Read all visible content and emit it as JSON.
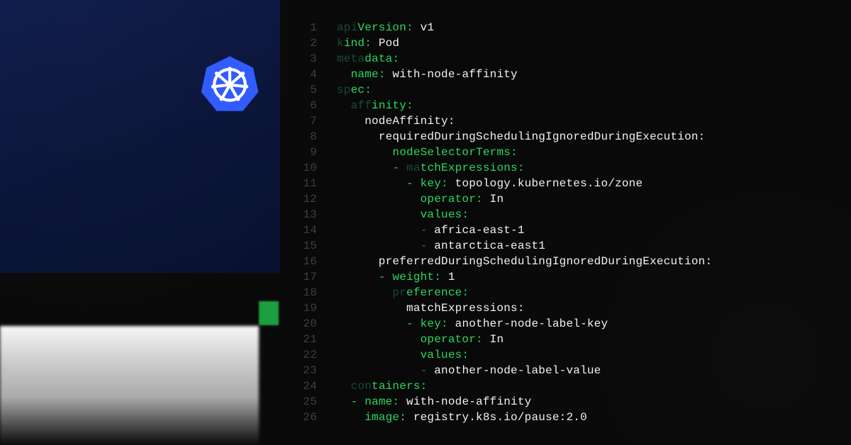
{
  "code": {
    "lines": [
      {
        "n": "1",
        "tokens": [
          {
            "cls": "dim",
            "t": "api"
          },
          {
            "cls": "key",
            "t": "Version:"
          },
          {
            "cls": "val",
            "t": " v1"
          }
        ]
      },
      {
        "n": "2",
        "tokens": [
          {
            "cls": "dim",
            "t": "k"
          },
          {
            "cls": "key",
            "t": "ind:"
          },
          {
            "cls": "val",
            "t": " Pod"
          }
        ]
      },
      {
        "n": "3",
        "tokens": [
          {
            "cls": "dim",
            "t": "meta"
          },
          {
            "cls": "key",
            "t": "data:"
          }
        ]
      },
      {
        "n": "4",
        "tokens": [
          {
            "cls": "val",
            "t": "  "
          },
          {
            "cls": "key",
            "t": "name:"
          },
          {
            "cls": "val",
            "t": " with-node-affinity"
          }
        ]
      },
      {
        "n": "5",
        "tokens": [
          {
            "cls": "dim",
            "t": "sp"
          },
          {
            "cls": "key",
            "t": "ec:"
          }
        ]
      },
      {
        "n": "6",
        "tokens": [
          {
            "cls": "val",
            "t": "  "
          },
          {
            "cls": "dim",
            "t": "aff"
          },
          {
            "cls": "key",
            "t": "inity:"
          }
        ]
      },
      {
        "n": "7",
        "tokens": [
          {
            "cls": "val",
            "t": "    nodeAffinity:"
          }
        ]
      },
      {
        "n": "8",
        "tokens": [
          {
            "cls": "val",
            "t": "      requiredDuringSchedulingIgnoredDuringExecution:"
          }
        ]
      },
      {
        "n": "9",
        "tokens": [
          {
            "cls": "val",
            "t": "        "
          },
          {
            "cls": "key",
            "t": "nodeSelectorTerms:"
          }
        ]
      },
      {
        "n": "10",
        "tokens": [
          {
            "cls": "val",
            "t": "        "
          },
          {
            "cls": "dash",
            "t": "- "
          },
          {
            "cls": "dim",
            "t": "ma"
          },
          {
            "cls": "key",
            "t": "tchExpressions:"
          }
        ]
      },
      {
        "n": "11",
        "tokens": [
          {
            "cls": "val",
            "t": "          "
          },
          {
            "cls": "dash",
            "t": "- "
          },
          {
            "cls": "key",
            "t": "key:"
          },
          {
            "cls": "val",
            "t": " topology.kubernetes.io/zone"
          }
        ]
      },
      {
        "n": "12",
        "tokens": [
          {
            "cls": "val",
            "t": "            "
          },
          {
            "cls": "key",
            "t": "operator:"
          },
          {
            "cls": "val",
            "t": " In"
          }
        ]
      },
      {
        "n": "13",
        "tokens": [
          {
            "cls": "val",
            "t": "            "
          },
          {
            "cls": "key",
            "t": "values:"
          }
        ]
      },
      {
        "n": "14",
        "tokens": [
          {
            "cls": "val",
            "t": "            "
          },
          {
            "cls": "dimw",
            "t": "- "
          },
          {
            "cls": "val",
            "t": "africa-east-1"
          }
        ]
      },
      {
        "n": "15",
        "tokens": [
          {
            "cls": "val",
            "t": "            "
          },
          {
            "cls": "dimw",
            "t": "- "
          },
          {
            "cls": "val",
            "t": "antarctica-east1"
          }
        ]
      },
      {
        "n": "16",
        "tokens": [
          {
            "cls": "val",
            "t": "      preferredDuringSchedulingIgnoredDuringExecution:"
          }
        ]
      },
      {
        "n": "17",
        "tokens": [
          {
            "cls": "val",
            "t": "      "
          },
          {
            "cls": "dash",
            "t": "- "
          },
          {
            "cls": "key",
            "t": "weight:"
          },
          {
            "cls": "num",
            "t": " 1"
          }
        ]
      },
      {
        "n": "18",
        "tokens": [
          {
            "cls": "val",
            "t": "        "
          },
          {
            "cls": "dim",
            "t": "pr"
          },
          {
            "cls": "key",
            "t": "eference:"
          }
        ]
      },
      {
        "n": "19",
        "tokens": [
          {
            "cls": "val",
            "t": "          matchExpressions:"
          }
        ]
      },
      {
        "n": "20",
        "tokens": [
          {
            "cls": "val",
            "t": "          "
          },
          {
            "cls": "dash",
            "t": "- "
          },
          {
            "cls": "key",
            "t": "key:"
          },
          {
            "cls": "val",
            "t": " another-node-label-key"
          }
        ]
      },
      {
        "n": "21",
        "tokens": [
          {
            "cls": "val",
            "t": "            "
          },
          {
            "cls": "key",
            "t": "operator:"
          },
          {
            "cls": "val",
            "t": " In"
          }
        ]
      },
      {
        "n": "22",
        "tokens": [
          {
            "cls": "val",
            "t": "            "
          },
          {
            "cls": "key",
            "t": "values:"
          }
        ]
      },
      {
        "n": "23",
        "tokens": [
          {
            "cls": "val",
            "t": "            "
          },
          {
            "cls": "dimw",
            "t": "- "
          },
          {
            "cls": "val",
            "t": "another-node-label-value"
          }
        ]
      },
      {
        "n": "24",
        "tokens": [
          {
            "cls": "val",
            "t": "  "
          },
          {
            "cls": "dim",
            "t": "con"
          },
          {
            "cls": "key",
            "t": "tainers:"
          }
        ]
      },
      {
        "n": "25",
        "tokens": [
          {
            "cls": "val",
            "t": "  "
          },
          {
            "cls": "dash",
            "t": "- "
          },
          {
            "cls": "key",
            "t": "name:"
          },
          {
            "cls": "val",
            "t": " with-node-affinity"
          }
        ]
      },
      {
        "n": "26",
        "tokens": [
          {
            "cls": "val",
            "t": "    "
          },
          {
            "cls": "key",
            "t": "image:"
          },
          {
            "cls": "val",
            "t": " registry.k8s.io/pause:2.0"
          }
        ]
      }
    ]
  },
  "logo": {
    "name": "kubernetes"
  }
}
